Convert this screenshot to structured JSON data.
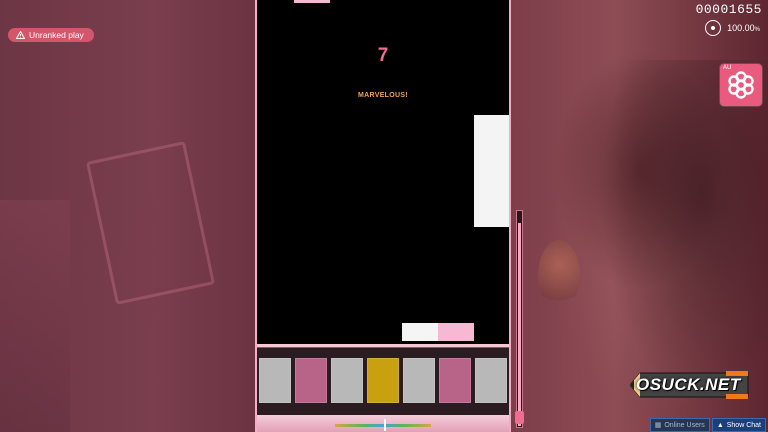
{
  "hud": {
    "score": "00001655",
    "accuracy": "100.00",
    "accuracy_unit": "%",
    "unranked_label": "Unranked play",
    "mod_tag": "AU"
  },
  "playfield": {
    "combo": "7",
    "judgement": "MARVELOUS!",
    "key_colors": [
      "#b8b8b8",
      "#b86488",
      "#b8b8b8",
      "#c8a010",
      "#b8b8b8",
      "#b86488",
      "#b8b8b8"
    ]
  },
  "health": {
    "level": 0.95
  },
  "watermark": {
    "text": "OSUCK.NET"
  },
  "bottom_bar": {
    "online_users": "Online Users",
    "show_chat": "Show Chat"
  }
}
